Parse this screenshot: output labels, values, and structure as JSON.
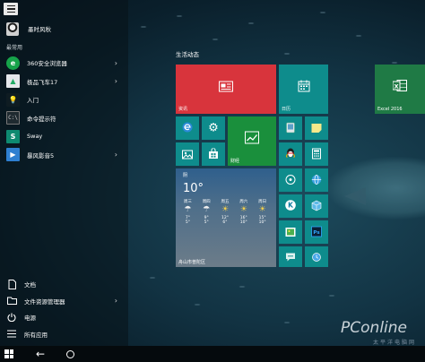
{
  "user": {
    "name": "墨时风秋"
  },
  "most_used_label": "最常用",
  "apps": [
    {
      "label": "360安全浏览器",
      "icon": "browser-360-icon",
      "has_submenu": true
    },
    {
      "label": "极品飞车17",
      "icon": "racing-game-icon",
      "has_submenu": true
    },
    {
      "label": "入门",
      "icon": "lightbulb-icon",
      "has_submenu": false
    },
    {
      "label": "命令提示符",
      "icon": "command-prompt-icon",
      "has_submenu": false
    },
    {
      "label": "Sway",
      "icon": "sway-icon",
      "has_submenu": false
    },
    {
      "label": "暴风影音5",
      "icon": "storm-player-icon",
      "has_submenu": true
    }
  ],
  "bottom_items": [
    {
      "label": "文档",
      "icon": "document-icon",
      "has_submenu": false
    },
    {
      "label": "文件资源管理器",
      "icon": "folder-icon",
      "has_submenu": true
    },
    {
      "label": "电源",
      "icon": "power-icon",
      "has_submenu": false
    },
    {
      "label": "所有应用",
      "icon": "list-icon",
      "has_submenu": false
    }
  ],
  "tile_group_title": "生活动态",
  "tiles": {
    "news_label": "资讯",
    "calendar_label": "日历",
    "finance_label": "财经",
    "excel_label": "Excel 2016"
  },
  "weather": {
    "condition": "阴",
    "temperature": "10°",
    "location": "舟山市普陀区",
    "forecast": [
      {
        "day": "周三",
        "icon": "cloud-rain",
        "high": "7°",
        "low": "5°"
      },
      {
        "day": "周四",
        "icon": "cloud-rain",
        "high": "9°",
        "low": "5°"
      },
      {
        "day": "周五",
        "icon": "sun",
        "high": "12°",
        "low": "6°"
      },
      {
        "day": "周六",
        "icon": "sun",
        "high": "16°",
        "low": "10°"
      },
      {
        "day": "周日",
        "icon": "sun",
        "high": "15°",
        "low": "10°"
      }
    ]
  },
  "colors": {
    "teal": "#0e8c8c",
    "news_red": "#d8343c",
    "finance_green": "#1a8f3c",
    "excel_green": "#1f7a45",
    "weather_top": "#2f5f8c",
    "weather_bottom": "#6c7c89"
  },
  "watermark": {
    "brand": "PConline",
    "sub": "太平洋电脑网"
  }
}
